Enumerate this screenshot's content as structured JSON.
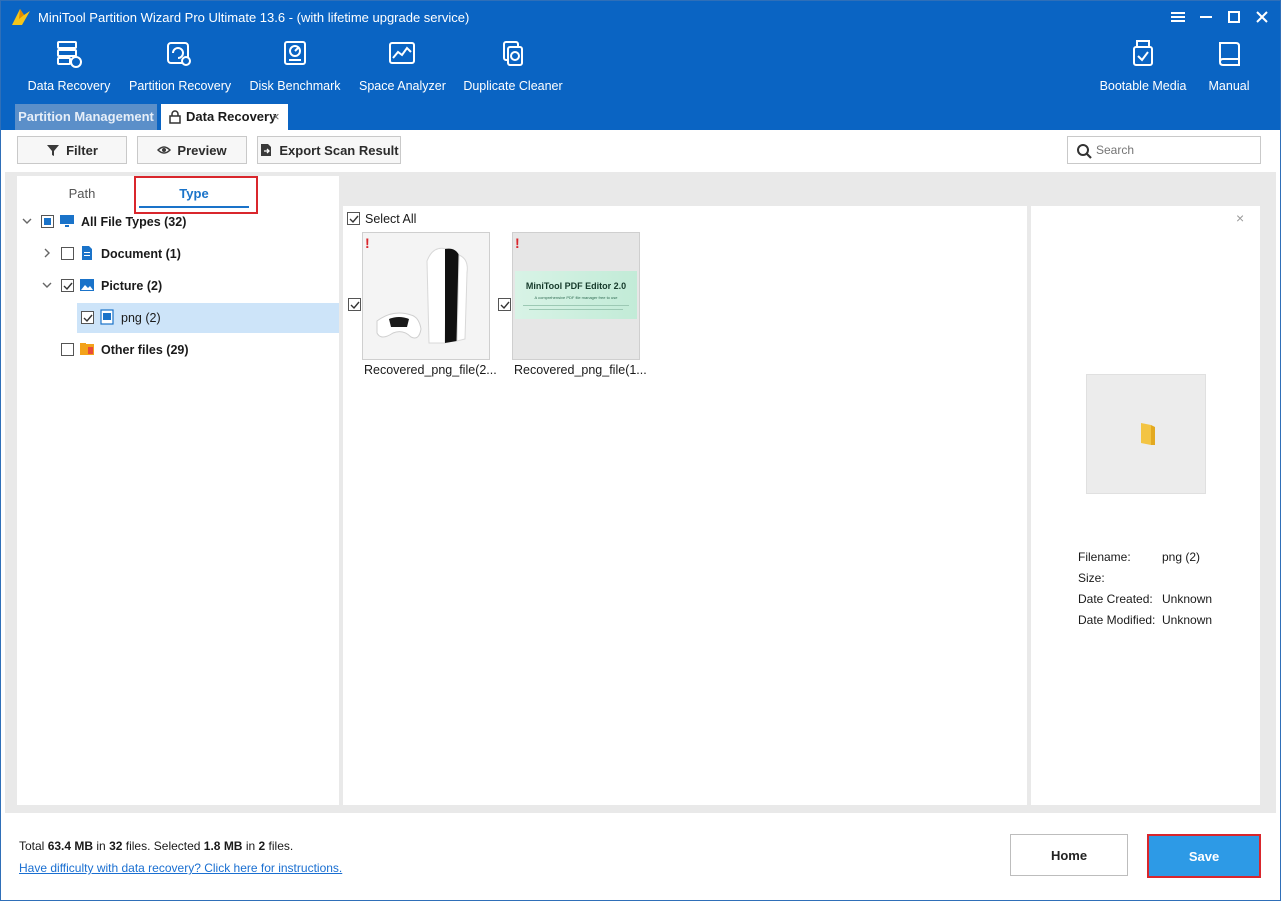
{
  "window": {
    "title": "MiniTool Partition Wizard Pro Ultimate 13.6 - (with lifetime upgrade service)",
    "icons": {
      "menu": "hamburger-icon",
      "minimize": "minimize-icon",
      "maximize": "maximize-icon",
      "close": "close-icon"
    }
  },
  "toolbar": {
    "items": [
      {
        "label": "Data Recovery",
        "icon": "data-recovery-icon"
      },
      {
        "label": "Partition Recovery",
        "icon": "partition-recovery-icon"
      },
      {
        "label": "Disk Benchmark",
        "icon": "disk-benchmark-icon"
      },
      {
        "label": "Space Analyzer",
        "icon": "space-analyzer-icon"
      },
      {
        "label": "Duplicate Cleaner",
        "icon": "duplicate-cleaner-icon"
      }
    ],
    "right_items": [
      {
        "label": "Bootable Media",
        "icon": "bootable-media-icon"
      },
      {
        "label": "Manual",
        "icon": "manual-icon"
      }
    ]
  },
  "tabs": {
    "partition_management": "Partition Management",
    "data_recovery": "Data Recovery",
    "close_glyph": "×"
  },
  "actions": {
    "filter": "Filter",
    "preview": "Preview",
    "export": "Export Scan Result",
    "search_placeholder": "Search"
  },
  "left_panel": {
    "tabs": {
      "path": "Path",
      "type": "Type",
      "active": "Type"
    },
    "tree": [
      {
        "label": "All File Types (32)",
        "bold": true,
        "checked": "partial",
        "expanded": true
      },
      {
        "label": "Document (1)",
        "bold": true,
        "checked": false,
        "expanded": false
      },
      {
        "label": "Picture (2)",
        "bold": true,
        "checked": true,
        "expanded": true
      },
      {
        "label": "png (2)",
        "bold": false,
        "checked": true,
        "selected": true
      },
      {
        "label": "Other files (29)",
        "bold": true,
        "checked": false
      }
    ]
  },
  "file_grid": {
    "select_all": "Select All",
    "files": [
      {
        "name": "Recovered_png_file(2...",
        "checked": true,
        "alert": "!"
      },
      {
        "name": "Recovered_png_file(1...",
        "checked": true,
        "alert": "!",
        "thumb_title": "MiniTool PDF Editor 2.0",
        "thumb_subtitle": "A comprehensive PDF file manager free to use"
      }
    ]
  },
  "preview": {
    "close_glyph": "×",
    "info": [
      {
        "key": "Filename:",
        "value": "png (2)"
      },
      {
        "key": "Size:",
        "value": ""
      },
      {
        "key": "Date Created:",
        "value": "Unknown"
      },
      {
        "key": "Date Modified:",
        "value": "Unknown"
      }
    ]
  },
  "footer": {
    "summary_total_prefix": "Total ",
    "total_size": "63.4 MB",
    "summary_in": " in ",
    "total_files": "32",
    "summary_files_selected": " files.  Selected ",
    "selected_size": "1.8 MB",
    "summary_in2": " in ",
    "selected_files": "2",
    "summary_files_end": " files.",
    "help_link": "Have difficulty with data recovery? Click here for instructions.",
    "home_button": "Home",
    "save_button": "Save"
  },
  "colors": {
    "brand_blue": "#0a64c3",
    "accent_blue": "#1a73c9",
    "save_blue": "#2d9ae6",
    "highlight_red": "#d9262c",
    "selection": "#cde4f9"
  }
}
